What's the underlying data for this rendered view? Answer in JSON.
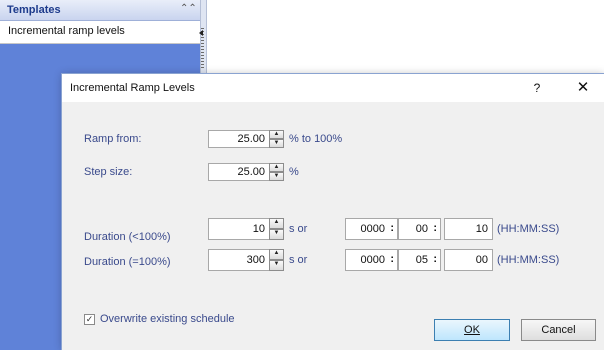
{
  "templates_pane": {
    "title": "Templates",
    "collapse_icon": "double-chevron-up",
    "items": [
      {
        "label": "Incremental ramp levels"
      }
    ]
  },
  "dialog": {
    "title": "Incremental Ramp Levels",
    "help_label": "?",
    "close_label": "✕",
    "ramp_from": {
      "label": "Ramp from:",
      "value": "25.00",
      "unit": "% to 100%"
    },
    "step_size": {
      "label": "Step size:",
      "value": "25.00",
      "unit": "%"
    },
    "duration_lt100": {
      "label": "Duration (<100%)",
      "seconds": "10",
      "or_label": "s or",
      "hh": "0000",
      "mm": "00",
      "ss": "10",
      "format": "(HH:MM:SS)"
    },
    "duration_eq100": {
      "label": "Duration (=100%)",
      "seconds": "300",
      "or_label": "s or",
      "hh": "0000",
      "mm": "05",
      "ss": "00",
      "format": "(HH:MM:SS)"
    },
    "overwrite": {
      "label": "Overwrite existing schedule",
      "checked": true
    },
    "ok_label": "OK",
    "cancel_label": "Cancel"
  },
  "colors": {
    "pane_blue": "#5f82d8",
    "label_blue": "#3a4a8c",
    "dialog_bg": "#f0f0f0"
  }
}
